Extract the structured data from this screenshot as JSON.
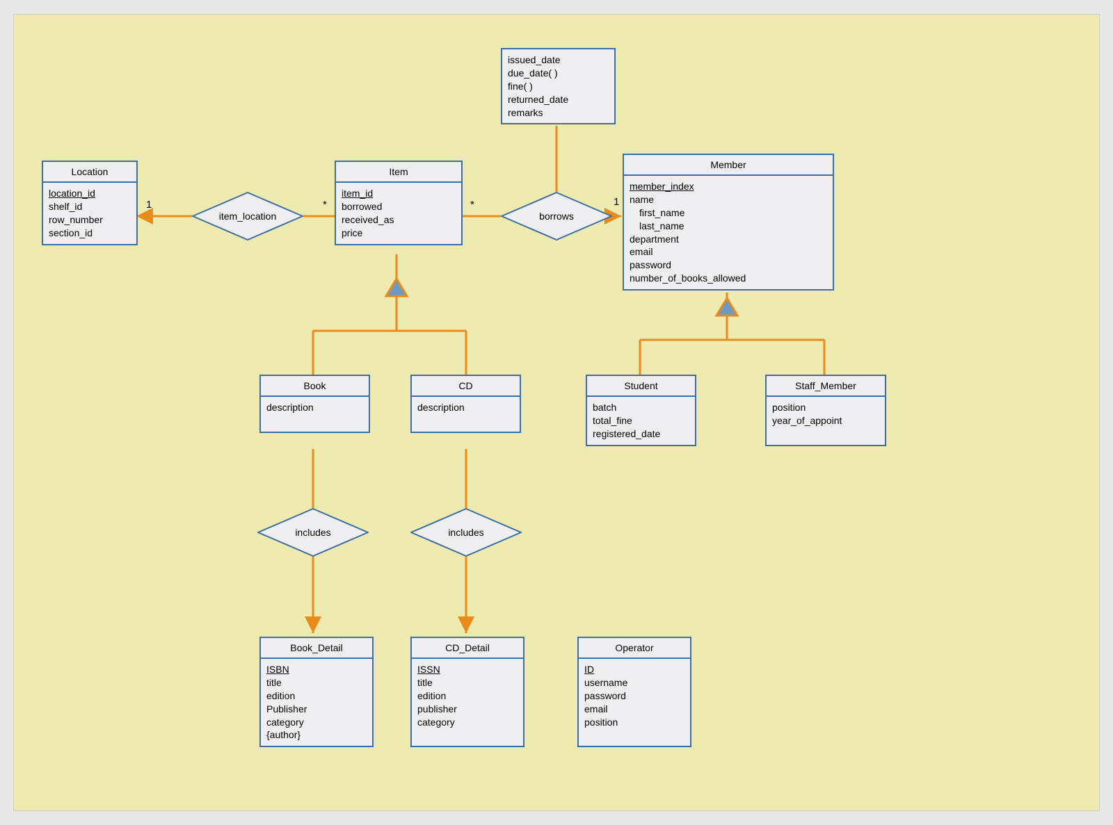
{
  "entities": {
    "location": {
      "title": "Location",
      "attrs": [
        "location_id",
        "shelf_id",
        "row_number",
        "section_id"
      ],
      "key": "location_id"
    },
    "item": {
      "title": "Item",
      "attrs": [
        "item_id",
        "borrowed",
        "received_as",
        "price"
      ],
      "key": "item_id"
    },
    "member": {
      "title": "Member",
      "attrs": [
        "member_index",
        "name",
        "first_name",
        "last_name",
        "department",
        "email",
        "password",
        "number_of_books_allowed"
      ],
      "key": "member_index",
      "sub": [
        "first_name",
        "last_name"
      ]
    },
    "book": {
      "title": "Book",
      "attrs": [
        "description"
      ]
    },
    "cd": {
      "title": "CD",
      "attrs": [
        "description"
      ]
    },
    "student": {
      "title": "Student",
      "attrs": [
        "batch",
        "total_fine",
        "registered_date"
      ]
    },
    "staff": {
      "title": "Staff_Member",
      "attrs": [
        "position",
        "year_of_appoint"
      ]
    },
    "book_detail": {
      "title": "Book_Detail",
      "attrs": [
        "ISBN",
        "title",
        "edition",
        "Publisher",
        "category",
        "{author}"
      ],
      "key": "ISBN"
    },
    "cd_detail": {
      "title": "CD_Detail",
      "attrs": [
        "ISSN",
        "title",
        "edition",
        "publisher",
        "category"
      ],
      "key": "ISSN"
    },
    "operator": {
      "title": "Operator",
      "attrs": [
        "ID",
        "username",
        "password",
        "email",
        "position"
      ],
      "key": "ID"
    }
  },
  "relations": {
    "item_location": "item_location",
    "borrows": "borrows",
    "includes1": "includes",
    "includes2": "includes"
  },
  "borrows_attrs": [
    "issued_date",
    "due_date( )",
    "fine( )",
    "returned_date",
    "remarks"
  ],
  "card": {
    "loc1": "1",
    "itemL": "*",
    "itemR": "*",
    "mem1": "1"
  }
}
